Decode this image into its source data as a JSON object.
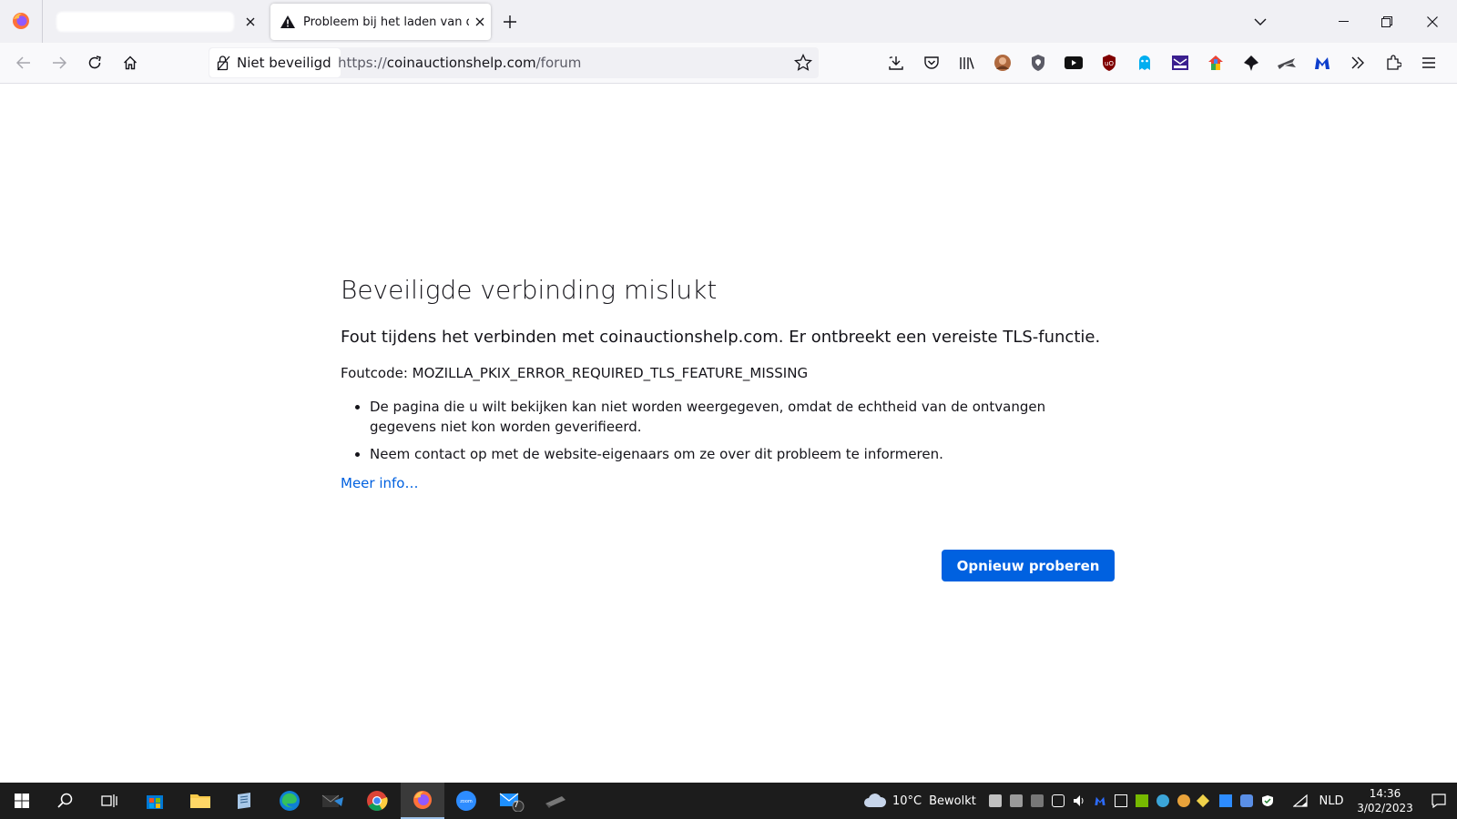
{
  "browser": {
    "tabs": [
      {
        "title": "",
        "active": false
      },
      {
        "title": "Probleem bij het laden van de pagina",
        "active": true
      }
    ],
    "toolbar": {
      "identity_label": "Niet beveiligd",
      "url_scheme": "https://",
      "url_host": "coinauctionshelp.com",
      "url_path": "/forum"
    },
    "extension_icons": [
      "download-icon",
      "pocket-icon",
      "library-icon",
      "profile-avatar-icon",
      "shield-extension-icon",
      "youtube-icon",
      "ublock-icon",
      "ghostery-icon",
      "mail-extension-icon",
      "colorful-extension-icon",
      "bird-extension-icon",
      "plane-extension-icon",
      "malwarebytes-icon",
      "more-tools-icon",
      "extensions-icon",
      "menu-icon"
    ]
  },
  "error": {
    "title": "Beveiligde verbinding mislukt",
    "intro": "Fout tijdens het verbinden met coinauctionshelp.com. Er ontbreekt een vereiste TLS-functie.",
    "code_label": "Foutcode: ",
    "code": "MOZILLA_PKIX_ERROR_REQUIRED_TLS_FEATURE_MISSING",
    "bullets": [
      "De pagina die u wilt bekijken kan niet worden weergegeven, omdat de echtheid van de ontvangen gegevens niet kon worden geverifieerd.",
      "Neem contact op met de website-eigenaars om ze over dit probleem te informeren."
    ],
    "learn_more": "Meer info…",
    "retry": "Opnieuw proberen"
  },
  "taskbar": {
    "weather_temp": "10°C",
    "weather_desc": "Bewolkt",
    "language": "NLD",
    "time": "14:36",
    "date": "3/02/2023",
    "mail_badge": "7",
    "zoom_label": "zoom"
  },
  "colors": {
    "accent": "#0061e0",
    "taskbar": "#1c1c1c",
    "tabstrip": "#f0f0f4"
  }
}
